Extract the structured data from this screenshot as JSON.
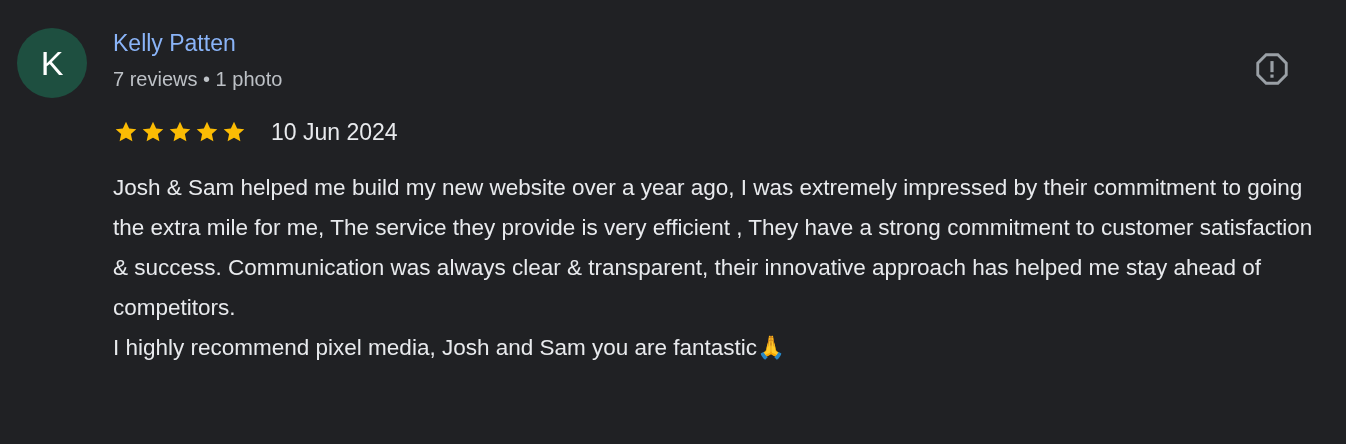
{
  "reviewer": {
    "initial": "K",
    "name": "Kelly Patten",
    "meta": "7 reviews • 1 photo"
  },
  "review": {
    "stars": 5,
    "date": "10 Jun 2024",
    "paragraphs": [
      "Josh & Sam helped me build my new website over a year ago, I was extremely impressed by their commitment to going the extra mile for me, The service they provide is very efficient , They have a strong commitment to customer satisfaction & success. Communication was always clear & transparent, their innovative approach has helped me stay ahead of competitors.",
      "I highly recommend pixel media, Josh and Sam you are fantastic🙏"
    ]
  }
}
